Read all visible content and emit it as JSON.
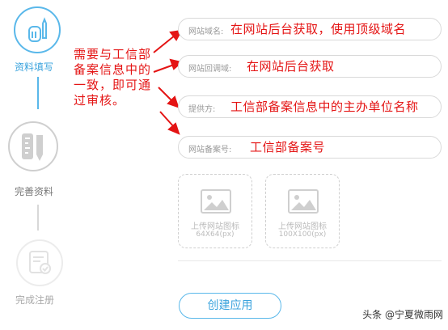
{
  "steps": [
    {
      "label": "资料填写",
      "icon": "document-pen-icon",
      "state": "active"
    },
    {
      "label": "完善资料",
      "icon": "ruler-pencil-icon",
      "state": "pending"
    },
    {
      "label": "完成注册",
      "icon": "certificate-icon",
      "state": "disabled"
    }
  ],
  "annotation": {
    "text": "需要与工信部备案信息中的一致，即可通过审核。"
  },
  "form": {
    "fields": [
      {
        "label": "网站域名:",
        "value": "在网站后台获取，使用顶级域名"
      },
      {
        "label": "网站回调域:",
        "value": "在网站后台获取"
      },
      {
        "label": "提供方:",
        "value": "工信部备案信息中的主办单位名称"
      },
      {
        "label": "网站备案号:",
        "value": "工信部备案号"
      }
    ],
    "uploads": [
      {
        "title": "上传网站图标",
        "size": "64X64(px)",
        "icon": "image-icon"
      },
      {
        "title": "上传网站图标",
        "size": "100X100(px)",
        "icon": "image-icon"
      }
    ],
    "submit_label": "创建应用"
  },
  "watermark": {
    "text": "头条 @宁夏微雨网"
  },
  "colors": {
    "accent": "#3aa3dd",
    "annotation": "#e41414",
    "border": "#d9d9d9"
  }
}
